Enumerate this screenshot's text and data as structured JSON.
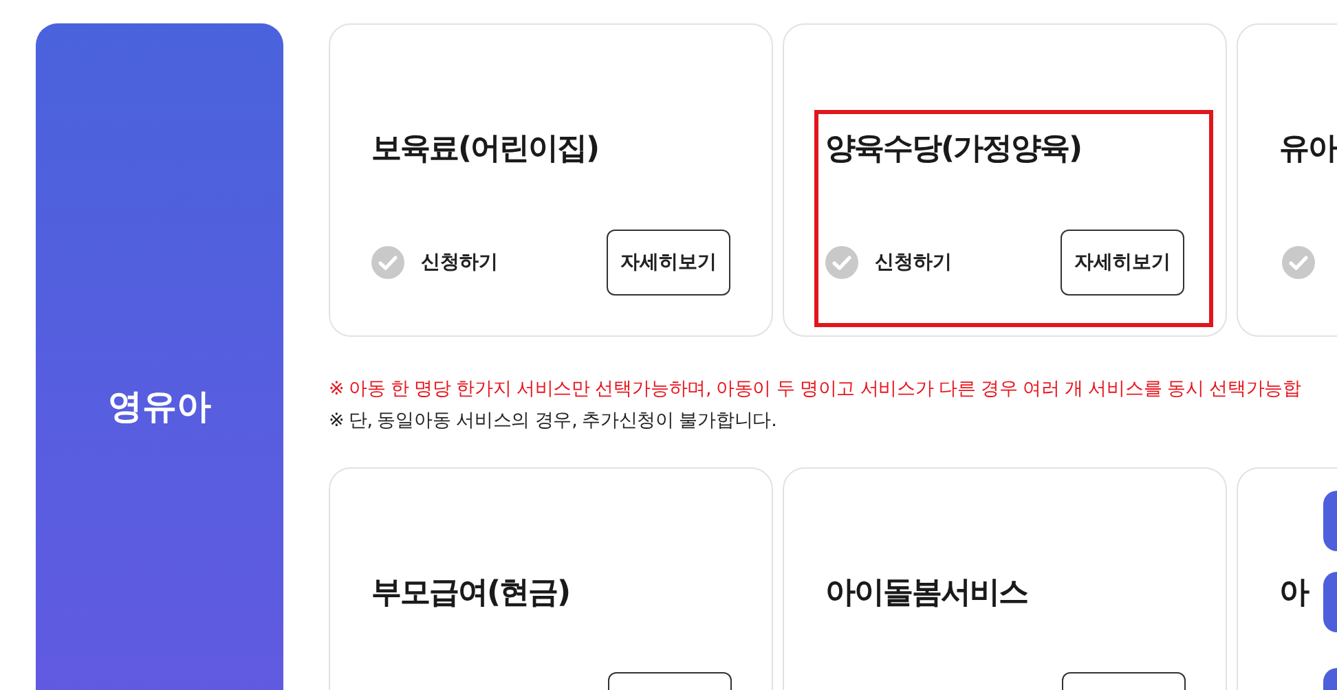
{
  "sidebar": {
    "title": "영유아"
  },
  "rows": [
    {
      "cards": [
        {
          "title": "보육료(어린이집)",
          "kind": "full",
          "apply_label": "신청하기",
          "applied": false,
          "detail_button": "자세히보기",
          "highlighted": false
        },
        {
          "title": "양육수당(가정양육)",
          "kind": "full",
          "apply_label": "신청하기",
          "applied": false,
          "detail_button": "자세히보기",
          "highlighted": true
        },
        {
          "title": "유아",
          "kind": "edge",
          "applied": false,
          "highlighted": false
        }
      ]
    },
    {
      "cards": [
        {
          "title": "부모급여(현금)",
          "kind": "partial",
          "highlighted": false
        },
        {
          "title": "아이돌봄서비스",
          "kind": "partial",
          "highlighted": false
        },
        {
          "title": "아",
          "kind": "edge_plain",
          "highlighted": false
        }
      ]
    }
  ],
  "notes": [
    {
      "text": "※ 아동 한 명당 한가지 서비스만 선택가능하며, 아동이 두 명이고 서비스가 다른 경우 여러 개 서비스를 동시 선택가능합",
      "kind": "warning"
    },
    {
      "text": "※ 단, 동일아동 서비스의 경우, 추가신청이 불가합니다.",
      "kind": "normal"
    }
  ]
}
